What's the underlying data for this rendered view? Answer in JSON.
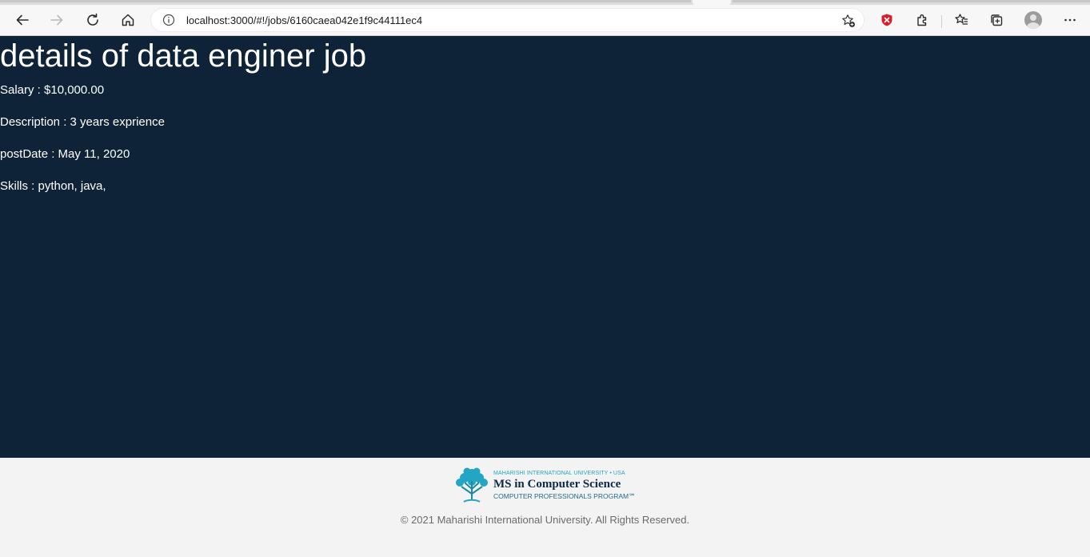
{
  "browser": {
    "url": "localhost:3000/#!/jobs/6160caea042e1f9c44111ec4",
    "colors": {
      "shield": "#d4202d"
    }
  },
  "job": {
    "title": "details of data enginer job",
    "salary": "Salary : $10,000.00",
    "description": "Description : 3 years exprience",
    "post_date": "postDate : May 11, 2020",
    "skills": "Skills : python, java,"
  },
  "footer": {
    "logo": {
      "top": "MAHARISHI INTERNATIONAL UNIVERSITY • USA",
      "main": "MS in Computer Science",
      "sub": "COMPUTER PROFESSIONALS PROGRAM℠"
    },
    "copyright": "© 2021 Maharishi International University. All Rights Reserved."
  },
  "colors": {
    "main_bg": "#0f2338",
    "footer_bg": "#f3f3f3",
    "logo_teal": "#23a6c3",
    "logo_navy": "#0e2a47"
  },
  "icons": [
    "back-arrow-icon",
    "forward-arrow-icon",
    "refresh-icon",
    "home-icon",
    "info-icon",
    "add-favorite-icon",
    "shield-icon",
    "extensions-icon",
    "favorites-icon",
    "collections-icon",
    "profile-avatar-icon",
    "more-menu-icon"
  ]
}
